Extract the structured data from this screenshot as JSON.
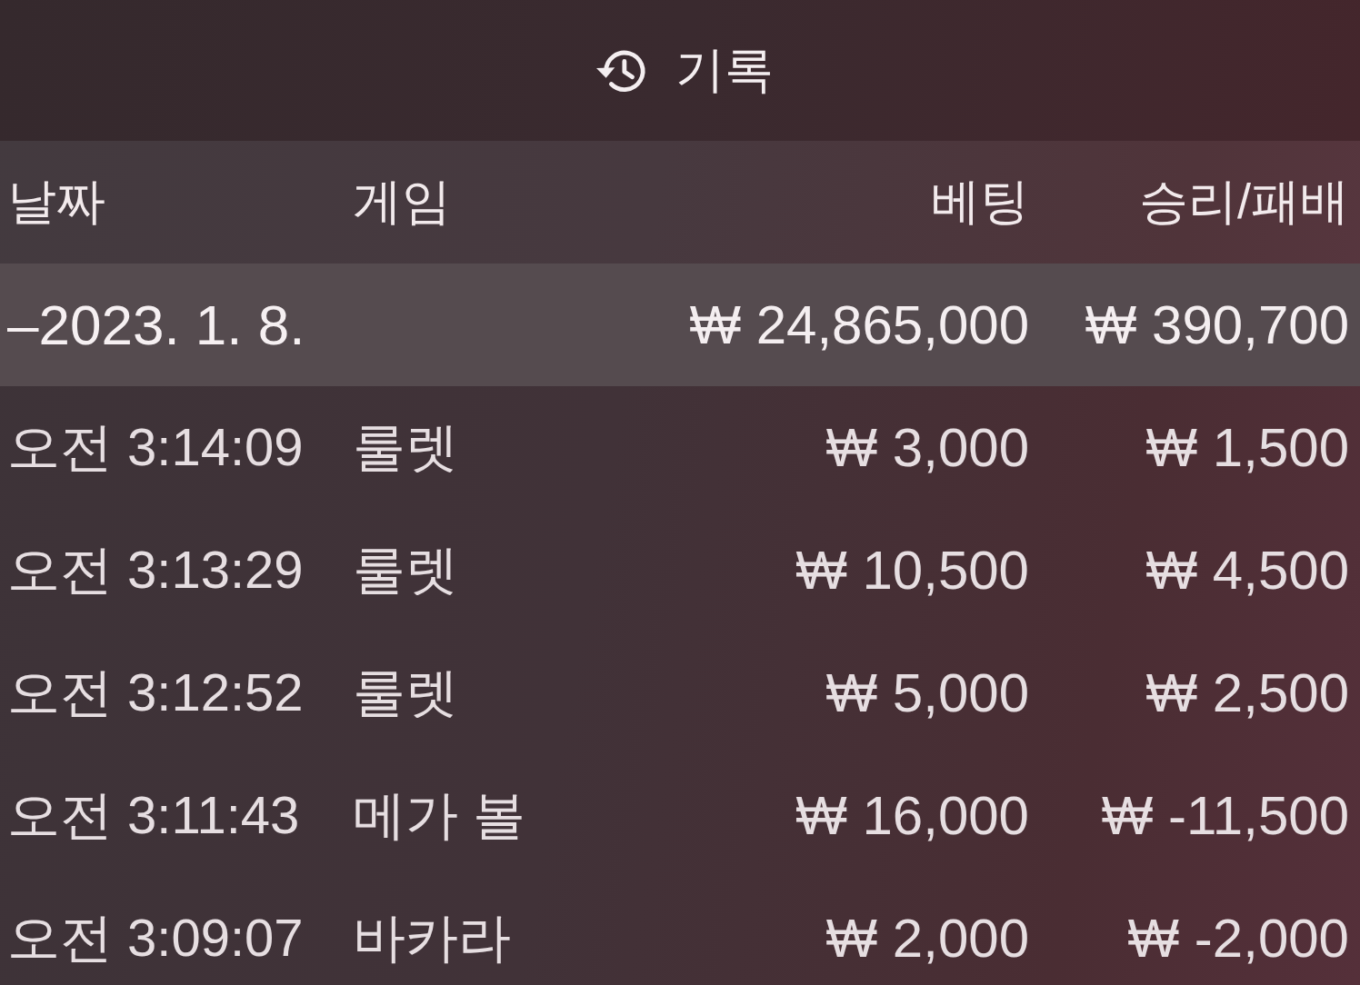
{
  "title": {
    "text": "기록"
  },
  "columns": [
    "날짜",
    "게임",
    "베팅",
    "승리/패배"
  ],
  "groups": [
    {
      "toggle": "–",
      "date": "2023. 1. 8.",
      "bet": "₩ 24,865,000",
      "result": "₩ 390,700",
      "rows": [
        {
          "time": "오전 3:14:09",
          "game": "룰렛",
          "bet": "₩ 3,000",
          "result": "₩ 1,500"
        },
        {
          "time": "오전 3:13:29",
          "game": "룰렛",
          "bet": "₩ 10,500",
          "result": "₩ 4,500"
        },
        {
          "time": "오전 3:12:52",
          "game": "룰렛",
          "bet": "₩ 5,000",
          "result": "₩ 2,500"
        },
        {
          "time": "오전 3:11:43",
          "game": "메가 볼",
          "bet": "₩ 16,000",
          "result": "₩ -11,500"
        },
        {
          "time": "오전 3:09:07",
          "game": "바카라",
          "bet": "₩ 2,000",
          "result": "₩ -2,000"
        }
      ]
    }
  ]
}
